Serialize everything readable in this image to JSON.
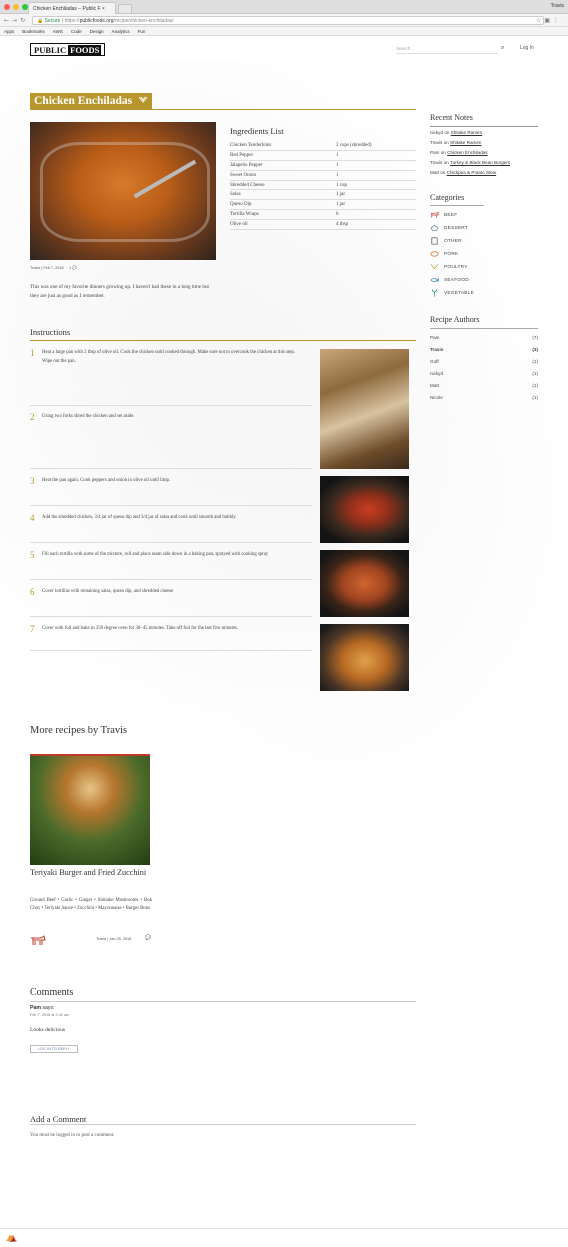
{
  "browser": {
    "tab_title": "Chicken Enchiladas – Public F",
    "user": "Travis",
    "secure_label": "Secure",
    "url_prefix": "https://",
    "url_host": "publicfoods.org",
    "url_path": "/recipe/chicken-enchiladas/",
    "bookmarks": [
      "Apps",
      "Bookmarks",
      "AWS",
      "Code",
      "Design",
      "Analytics",
      "Fun"
    ]
  },
  "site": {
    "logo_left": "PUBLIC",
    "logo_right": "FOODS",
    "search_placeholder": "Search...",
    "login": "Log In"
  },
  "recipe": {
    "title": "Chicken Enchiladas",
    "author": "Travis",
    "date": "Feb 7, 2018",
    "comment_count": "1",
    "description": "This was one of my favorite dinners growing up. I haven't had these in a long time but they are just as good as I remember.",
    "ingredients_heading": "Ingredients List",
    "ingredients": [
      {
        "name": "Chicken Tenderloins",
        "qty": "2 cups (shredded)"
      },
      {
        "name": "Red Pepper",
        "qty": "1"
      },
      {
        "name": "Jalapeño Pepper",
        "qty": "1"
      },
      {
        "name": "Sweet Onion",
        "qty": "1"
      },
      {
        "name": "Shredded Cheese",
        "qty": "1 cup"
      },
      {
        "name": "Salsa",
        "qty": "1 jar"
      },
      {
        "name": "Queso Dip",
        "qty": "1 jar"
      },
      {
        "name": "Tortilla Wraps",
        "qty": "6"
      },
      {
        "name": "Olive oil",
        "qty": "4 tbsp"
      }
    ],
    "instructions_heading": "Instructions",
    "steps": [
      {
        "n": "1",
        "text": "Heat a large pan with 2 tbsp of olive oil. Cook the chicken until cooked through. Make sure not to overcook the chicken at this step. Wipe out the pan."
      },
      {
        "n": "2",
        "text": "Using two forks shred the chicken and set aside."
      },
      {
        "n": "3",
        "text": "Heat the pan again. Cook peppers and onion in olive oil until limp."
      },
      {
        "n": "4",
        "text": "Add the shredded chicken, 3/4 jar of queso dip and 3/4 jar of salsa and cook until smooth and bubbly."
      },
      {
        "n": "5",
        "text": "Fill each tortilla with some of the mixture, roll and place seam side down in a baking pan, sprayed with cooking spray"
      },
      {
        "n": "6",
        "text": "Cover tortillas with remaining salsa, queso dip, and shredded cheese"
      },
      {
        "n": "7",
        "text": "Cover with foil and bake in 350 degree oven for 30–45 minutes. Take off foil for the last five minutes."
      }
    ]
  },
  "sidebar": {
    "recent_notes_heading": "Recent Notes",
    "notes": [
      {
        "who": "nickyd",
        "on": "on",
        "recipe": "Shitake Ramen"
      },
      {
        "who": "Travis",
        "on": "on",
        "recipe": "Shitake Ramen"
      },
      {
        "who": "Pam",
        "on": "on",
        "recipe": "Chicken Enchiladas"
      },
      {
        "who": "Travis",
        "on": "on",
        "recipe": "Turkey & Black Bean Burgers"
      },
      {
        "who": "Matt",
        "on": "on",
        "recipe": "Chickpea & Potato Stew"
      }
    ],
    "categories_heading": "Categories",
    "categories": [
      "BEEF",
      "DESSERT",
      "OTHER",
      "PORK",
      "POULTRY",
      "SEAFOOD",
      "VEGETABLE"
    ],
    "authors_heading": "Recipe Authors",
    "authors": [
      {
        "name": "Pam",
        "count": "(7)"
      },
      {
        "name": "Travis",
        "count": "(3)"
      },
      {
        "name": "Goff",
        "count": "(1)"
      },
      {
        "name": "nickyd",
        "count": "(1)"
      },
      {
        "name": "Matt",
        "count": "(1)"
      },
      {
        "name": "Nicole",
        "count": "(1)"
      }
    ]
  },
  "more": {
    "heading": "More recipes by Travis",
    "card_title": "Teriyaki Burger and Fried Zucchini",
    "card_ingredients": "Ground Beef • Garlic • Ginger • Shiitake Mushrooms • Bok Choy • Teriyaki Sauce • Zucchini • Mayonnaise • Burger Buns",
    "card_author": "Travis",
    "card_date": "Jan 25, 2018"
  },
  "comments": {
    "heading": "Comments",
    "author": "Pam",
    "says": "says:",
    "date": "Feb 7, 2018 at 2:42 am",
    "text": "Looks delicious",
    "reply": "LOG IN TO REPLY",
    "add_heading": "Add a Comment",
    "must_login": "You must be logged in to post a comment."
  },
  "colors": {
    "accent": "#b8962e",
    "cat_icon": "#c0392b"
  }
}
